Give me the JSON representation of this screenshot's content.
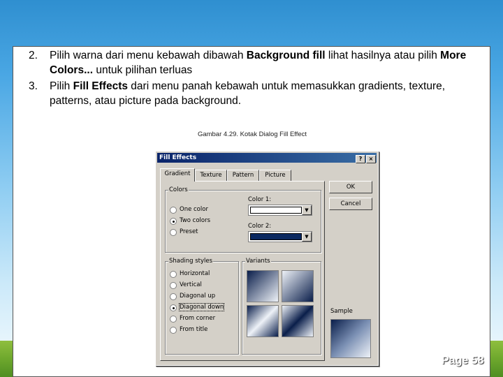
{
  "slide": {
    "items": [
      {
        "num": "2.",
        "parts": [
          "Pilih warna dari menu kebawah dibawah ",
          "Background fill",
          " lihat hasilnya atau pilih ",
          "More Colors...",
          " untuk pilihan terluas"
        ]
      },
      {
        "num": "3.",
        "parts": [
          "Pilih ",
          "Fill Effects",
          " dari menu panah kebawah untuk memasukkan gradients, texture, patterns, atau picture pada background."
        ]
      }
    ],
    "caption": "Gambar 4.29. Kotak Dialog Fill Effect",
    "page": "Page 58"
  },
  "dialog": {
    "title": "Fill Effects",
    "help_glyph": "?",
    "close_glyph": "×",
    "tabs": [
      "Gradient",
      "Texture",
      "Pattern",
      "Picture"
    ],
    "active_tab": "Gradient",
    "colors_group": "Colors",
    "color_options": [
      "One color",
      "Two colors",
      "Preset"
    ],
    "selected_color_option": "Two colors",
    "color1_label": "Color 1:",
    "color2_label": "Color 2:",
    "color1_value": "#ffffff",
    "color2_value": "#0a2860",
    "shading_group": "Shading styles",
    "shading_options": [
      "Horizontal",
      "Vertical",
      "Diagonal up",
      "Diagonal down",
      "From corner",
      "From title"
    ],
    "selected_shading": "Diagonal down",
    "variants_group": "Variants",
    "sample_label": "Sample",
    "ok_label": "OK",
    "cancel_label": "Cancel"
  }
}
